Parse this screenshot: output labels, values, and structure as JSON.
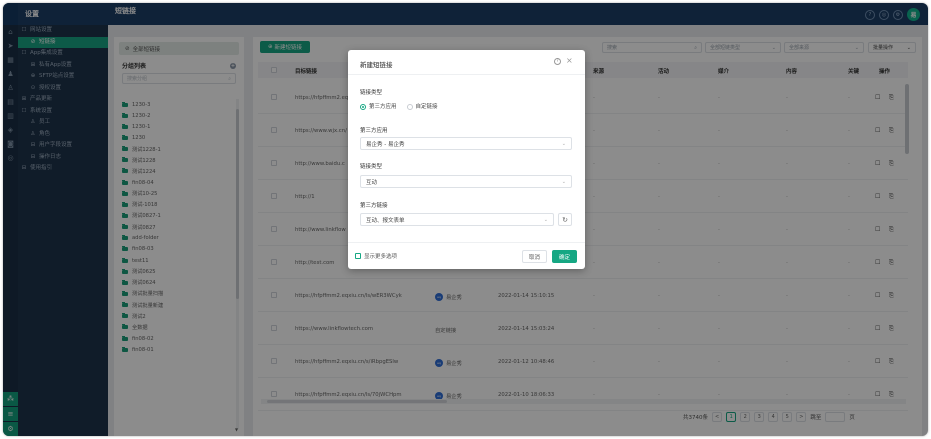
{
  "nav": {
    "title": "设置",
    "items": [
      {
        "label": "网站设置",
        "level": 0,
        "icon": "☐"
      },
      {
        "label": "短链接",
        "level": 1,
        "icon": "⊘",
        "selected": true
      },
      {
        "label": "App集成设置",
        "level": 0,
        "icon": "☐"
      },
      {
        "label": "私有App设置",
        "level": 1,
        "icon": "⊞"
      },
      {
        "label": "SFTP站点设置",
        "level": 1,
        "icon": "⊕"
      },
      {
        "label": "授权设置",
        "level": 1,
        "icon": "⊙"
      },
      {
        "label": "产品更新",
        "level": 0,
        "icon": "⊞"
      },
      {
        "label": "系统设置",
        "level": 0,
        "icon": "☐"
      },
      {
        "label": "员工",
        "level": 1,
        "icon": "♙"
      },
      {
        "label": "角色",
        "level": 1,
        "icon": "♙"
      },
      {
        "label": "用户字段设置",
        "level": 1,
        "icon": "⊟"
      },
      {
        "label": "操作日志",
        "level": 1,
        "icon": "⊟"
      },
      {
        "label": "使用指引",
        "level": 0,
        "icon": "⊟"
      }
    ]
  },
  "topbar": {
    "title": "短链接",
    "icons": [
      "?",
      "◎",
      "⚙"
    ],
    "avatar": "易"
  },
  "groups": {
    "all_label": "全部短链接",
    "header": "分组列表",
    "add_symbol": "+",
    "search_placeholder": "搜索分组",
    "items": [
      "1230-3",
      "1230-2",
      "1230-1",
      "1230",
      "测试1228-1",
      "测试1228",
      "测试1224",
      "fin08-04",
      "测试10-25",
      "测试-1018",
      "测试0827-1",
      "测试0827",
      "add-folder",
      "fin08-03",
      "test11",
      "测试0625",
      "测试0624",
      "测试批量扫描",
      "测试批量新建",
      "测试2",
      "全数据",
      "fin08-02",
      "fin08-01"
    ]
  },
  "main": {
    "new_button": "新建短链接",
    "search_placeholder": "搜索",
    "filter_type": "全部短链类型",
    "filter_source": "全部来源",
    "batch_label": "批量操作",
    "columns": {
      "short_link": "目标链接",
      "source": "来源",
      "campaign": "活动",
      "media": "媒介",
      "content": "内容",
      "keyword": "关键",
      "ops": "操作"
    },
    "rows": [
      {
        "url": "https://hfpffmm2.eqxiu.cn/s/",
        "source": "",
        "date": "",
        "badge": false
      },
      {
        "url": "https://www.wjx.cn/",
        "source": "",
        "date": "",
        "badge": false
      },
      {
        "url": "http://www.baidu.c",
        "source": "",
        "date": "",
        "badge": false
      },
      {
        "url": "http://1",
        "source": "",
        "date": "",
        "badge": false
      },
      {
        "url": "http://www.linkflow",
        "source": "",
        "date": "",
        "badge": false
      },
      {
        "url": "http://test.com",
        "source": "",
        "date": "",
        "badge": false
      },
      {
        "url": "https://hfpffmm2.eqxiu.cn/ls/wER3WCyk",
        "source": "易企秀",
        "date": "2022-01-14 15:10:15",
        "badge": true
      },
      {
        "url": "https://www.linkflowtech.com",
        "source": "自定链接",
        "date": "2022-01-14 15:03:24",
        "badge": false
      },
      {
        "url": "https://hfpffmm2.eqxiu.cn/s/iRbpgESlw",
        "source": "易企秀",
        "date": "2022-01-12 10:48:46",
        "badge": true
      },
      {
        "url": "https://hfpffmm2.eqxiu.cn/ls/70jWCHpm",
        "source": "易企秀",
        "date": "2022-01-10 18:06:33",
        "badge": true
      }
    ],
    "badge_text": "eq",
    "dash": "-",
    "ops_icons": [
      "☐",
      "⎘"
    ],
    "pager": {
      "total": "共3740条",
      "prev": "<",
      "pages": [
        "1",
        "2",
        "3",
        "4",
        "5"
      ],
      "next": ">",
      "goto": "跳至",
      "page_unit": "页"
    }
  },
  "modal": {
    "title": "新建短链接",
    "help_icon": "?",
    "close_icon": "×",
    "link_type_label": "链接类型",
    "radio_options": [
      "第三方应用",
      "自定链接"
    ],
    "third_party_label": "第三方应用",
    "third_party_value": "易企秀 - 易企秀",
    "link_kind_label": "链接类型",
    "link_kind_value": "互动",
    "third_link_label": "第三方链接",
    "third_link_value": "互动、报文表单",
    "refresh_icon": "↻",
    "show_more": "显示更多选项",
    "cancel": "取消",
    "ok": "确定"
  }
}
